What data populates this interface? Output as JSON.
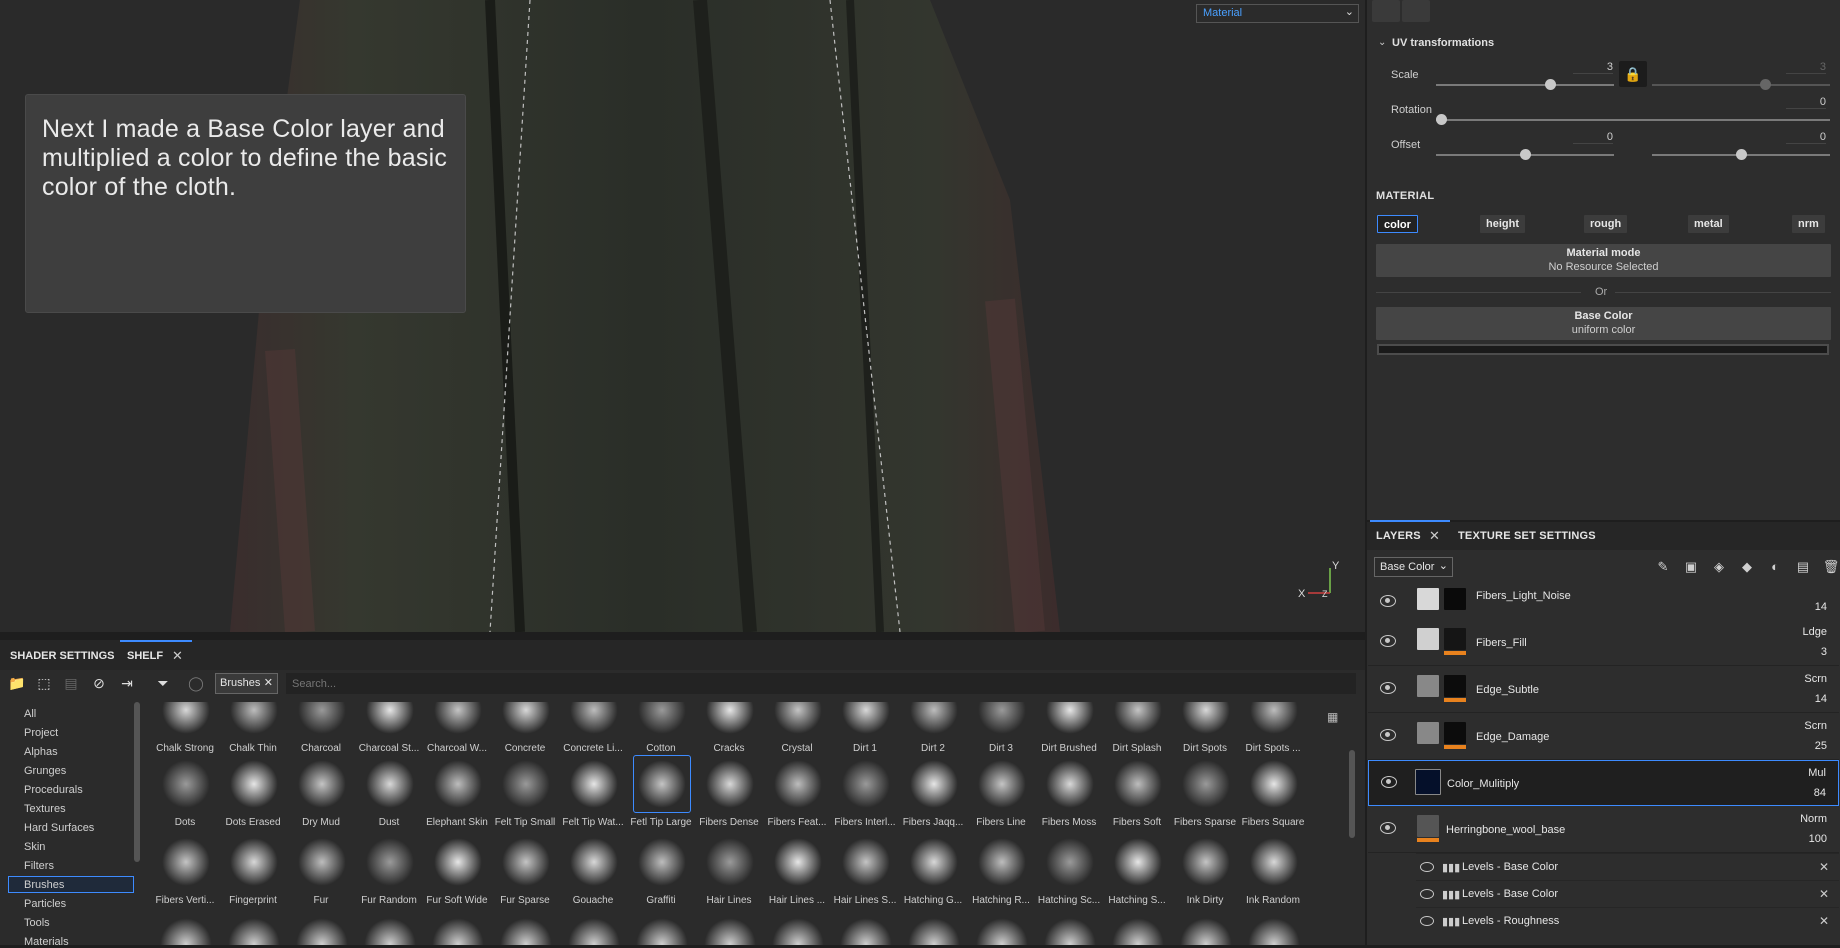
{
  "viewport": {
    "caption": "Next I made a Base Color layer and multiplied a color to define the basic color of the cloth.",
    "mode_select": "Material",
    "axis_y": "Y",
    "axis_x": "X",
    "axis_z": "Z"
  },
  "properties": {
    "uv_title": "UV transformations",
    "scale_label": "Scale",
    "scale_value": "3",
    "scale_value2": "3",
    "rotation_label": "Rotation",
    "rotation_value": "0",
    "offset_label": "Offset",
    "offset_value_x": "0",
    "offset_value_y": "0",
    "material_title": "MATERIAL",
    "channels": [
      "color",
      "height",
      "rough",
      "metal",
      "nrm"
    ],
    "material_mode_title": "Material mode",
    "material_mode_value": "No Resource Selected",
    "or_label": "Or",
    "base_color_title": "Base Color",
    "base_color_value": "uniform color"
  },
  "layers_panel": {
    "tab_layers": "LAYERS",
    "tab_texture_set": "TEXTURE SET SETTINGS",
    "channel_select": "Base Color",
    "layers": [
      {
        "name": "Fibers_Light_Noise",
        "blend": "",
        "opacity": "14"
      },
      {
        "name": "Fibers_Fill",
        "blend": "Ldge",
        "opacity": "3"
      },
      {
        "name": "Edge_Subtle",
        "blend": "Scrn",
        "opacity": "14"
      },
      {
        "name": "Edge_Damage",
        "blend": "Scrn",
        "opacity": "25"
      },
      {
        "name": "Color_Mulitiply",
        "blend": "Mul",
        "opacity": "84"
      },
      {
        "name": "Herringbone_wool_base",
        "blend": "Norm",
        "opacity": "100"
      }
    ],
    "effects": [
      "Levels - Base Color",
      "Levels - Base Color",
      "Levels - Roughness"
    ]
  },
  "shelf": {
    "tab_shader": "SHADER SETTINGS",
    "tab_shelf": "SHELF",
    "brush_tag": "Brushes",
    "search_placeholder": "Search...",
    "categories": [
      "All",
      "Project",
      "Alphas",
      "Grunges",
      "Procedurals",
      "Textures",
      "Hard Surfaces",
      "Skin",
      "Filters",
      "Brushes",
      "Particles",
      "Tools",
      "Materials"
    ],
    "selected_category": "Brushes",
    "row1": [
      "Chalk Strong",
      "Chalk Thin",
      "Charcoal",
      "Charcoal St...",
      "Charcoal W...",
      "Concrete",
      "Concrete Li...",
      "Cotton",
      "Cracks",
      "Crystal",
      "Dirt 1",
      "Dirt 2",
      "Dirt 3",
      "Dirt Brushed",
      "Dirt Splash",
      "Dirt Spots",
      "Dirt Spots ..."
    ],
    "row2": [
      "Dots",
      "Dots Erased",
      "Dry Mud",
      "Dust",
      "Elephant Skin",
      "Felt Tip Small",
      "Felt Tip Wat...",
      "Fetl Tip Large",
      "Fibers Dense",
      "Fibers Feat...",
      "Fibers Interl...",
      "Fibers Jaqq...",
      "Fibers Line",
      "Fibers Moss",
      "Fibers Soft",
      "Fibers Sparse",
      "Fibers Square"
    ],
    "row3": [
      "Fibers Verti...",
      "Fingerprint",
      "Fur",
      "Fur Random",
      "Fur Soft Wide",
      "Fur Sparse",
      "Gouache",
      "Graffiti",
      "Hair Lines",
      "Hair Lines ...",
      "Hair Lines S...",
      "Hatching G...",
      "Hatching R...",
      "Hatching Sc...",
      "Hatching S...",
      "Ink Dirty",
      "Ink Random"
    ]
  },
  "colors": {
    "accent": "#3d8bff",
    "orange": "#e8821e"
  }
}
